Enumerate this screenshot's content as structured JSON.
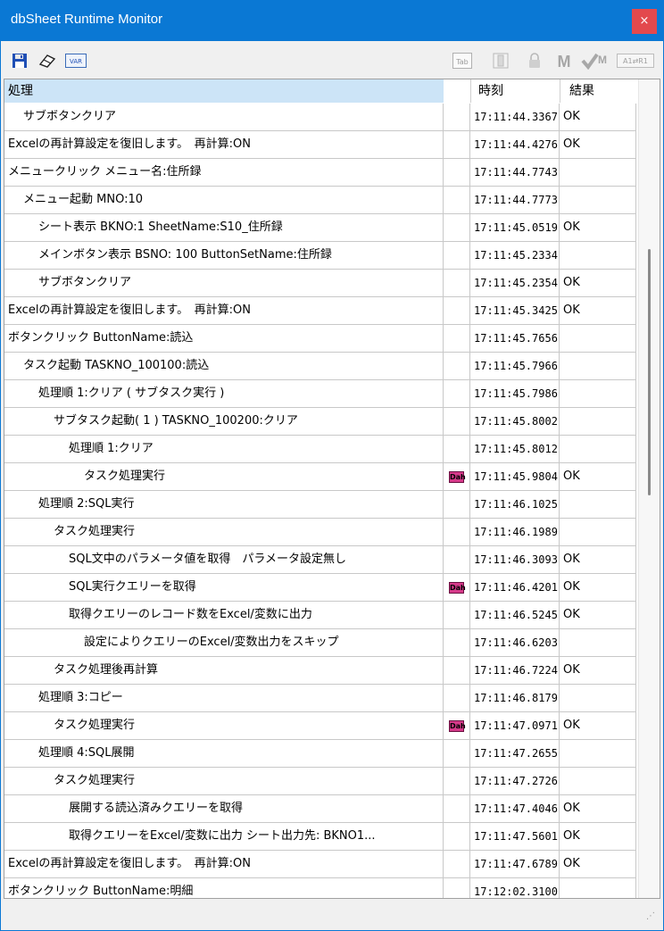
{
  "window": {
    "title": "dbSheet Runtime Monitor",
    "close_glyph": "×"
  },
  "toolbar": {
    "left_icons": [
      "save-icon",
      "eraser-icon",
      "var-icon"
    ],
    "var_label": "VAR",
    "right_icons": [
      "tab-icon",
      "panel-icon",
      "lock-icon",
      "m-icon",
      "check-m-icon",
      "a1-r1-icon"
    ],
    "tab_label": "Tab",
    "a1_label": "A1⇄R1"
  },
  "grid": {
    "columns": [
      "処理",
      "",
      "時刻",
      "結果"
    ],
    "rows": [
      {
        "process": "サブボタンクリア",
        "indent": 1,
        "icon": "",
        "time": "17:11:44.3367",
        "result": "OK"
      },
      {
        "process": "Excelの再計算設定を復旧します。　再計算:ON",
        "indent": 0,
        "icon": "",
        "time": "17:11:44.4276",
        "result": "OK"
      },
      {
        "process": "メニュークリック メニュー名:住所録",
        "indent": 0,
        "icon": "",
        "time": "17:11:44.7743",
        "result": ""
      },
      {
        "process": "メニュー起動 MNO:10",
        "indent": 1,
        "icon": "",
        "time": "17:11:44.7773",
        "result": ""
      },
      {
        "process": "シート表示 BKNO:1 SheetName:S10_住所録",
        "indent": 2,
        "icon": "",
        "time": "17:11:45.0519",
        "result": "OK"
      },
      {
        "process": "メインボタン表示 BSNO: 100 ButtonSetName:住所録",
        "indent": 2,
        "icon": "",
        "time": "17:11:45.2334",
        "result": ""
      },
      {
        "process": "サブボタンクリア",
        "indent": 2,
        "icon": "",
        "time": "17:11:45.2354",
        "result": "OK"
      },
      {
        "process": "Excelの再計算設定を復旧します。　再計算:ON",
        "indent": 0,
        "icon": "",
        "time": "17:11:45.3425",
        "result": "OK"
      },
      {
        "process": "ボタンクリック ButtonName:読込",
        "indent": 0,
        "icon": "",
        "time": "17:11:45.7656",
        "result": ""
      },
      {
        "process": "タスク起動 TASKNO_100100:読込",
        "indent": 1,
        "icon": "",
        "time": "17:11:45.7966",
        "result": ""
      },
      {
        "process": "処理順 1:クリア ( サブタスク実行 )",
        "indent": 2,
        "icon": "",
        "time": "17:11:45.7986",
        "result": ""
      },
      {
        "process": "サブタスク起動( 1 ) TASKNO_100200:クリア",
        "indent": 3,
        "icon": "",
        "time": "17:11:45.8002",
        "result": ""
      },
      {
        "process": "処理順 1:クリア",
        "indent": 4,
        "icon": "",
        "time": "17:11:45.8012",
        "result": ""
      },
      {
        "process": "タスク処理実行",
        "indent": 5,
        "icon": "Dah",
        "time": "17:11:45.9804",
        "result": "OK"
      },
      {
        "process": "処理順 2:SQL実行",
        "indent": 2,
        "icon": "",
        "time": "17:11:46.1025",
        "result": ""
      },
      {
        "process": "タスク処理実行",
        "indent": 3,
        "icon": "",
        "time": "17:11:46.1989",
        "result": ""
      },
      {
        "process": "SQL文中のパラメータ値を取得　パラメータ設定無し",
        "indent": 4,
        "icon": "",
        "time": "17:11:46.3093",
        "result": "OK"
      },
      {
        "process": "SQL実行クエリーを取得",
        "indent": 4,
        "icon": "Dah",
        "time": "17:11:46.4201",
        "result": "OK"
      },
      {
        "process": "取得クエリーのレコード数をExcel/変数に出力",
        "indent": 4,
        "icon": "",
        "time": "17:11:46.5245",
        "result": "OK"
      },
      {
        "process": "設定によりクエリーのExcel/変数出力をスキップ",
        "indent": 5,
        "icon": "",
        "time": "17:11:46.6203",
        "result": ""
      },
      {
        "process": "タスク処理後再計算",
        "indent": 3,
        "icon": "",
        "time": "17:11:46.7224",
        "result": "OK"
      },
      {
        "process": "処理順 3:コピー",
        "indent": 2,
        "icon": "",
        "time": "17:11:46.8179",
        "result": ""
      },
      {
        "process": "タスク処理実行",
        "indent": 3,
        "icon": "Dah",
        "time": "17:11:47.0971",
        "result": "OK"
      },
      {
        "process": "処理順 4:SQL展開",
        "indent": 2,
        "icon": "",
        "time": "17:11:47.2655",
        "result": ""
      },
      {
        "process": "タスク処理実行",
        "indent": 3,
        "icon": "",
        "time": "17:11:47.2726",
        "result": ""
      },
      {
        "process": "展開する読込済みクエリーを取得",
        "indent": 4,
        "icon": "",
        "time": "17:11:47.4046",
        "result": "OK"
      },
      {
        "process": "取得クエリーをExcel/変数に出力 シート出力先: BKNO1...",
        "indent": 4,
        "icon": "",
        "time": "17:11:47.5601",
        "result": "OK"
      },
      {
        "process": "Excelの再計算設定を復旧します。　再計算:ON",
        "indent": 0,
        "icon": "",
        "time": "17:11:47.6789",
        "result": "OK"
      },
      {
        "process": "ボタンクリック ButtonName:明細",
        "indent": 0,
        "icon": "",
        "time": "17:12:02.3100",
        "result": ""
      }
    ]
  },
  "colors": {
    "titlebar": "#0a78d4",
    "close": "#e3494d",
    "header_selected": "#cce4f7",
    "dblogo": "#d63a8a"
  }
}
